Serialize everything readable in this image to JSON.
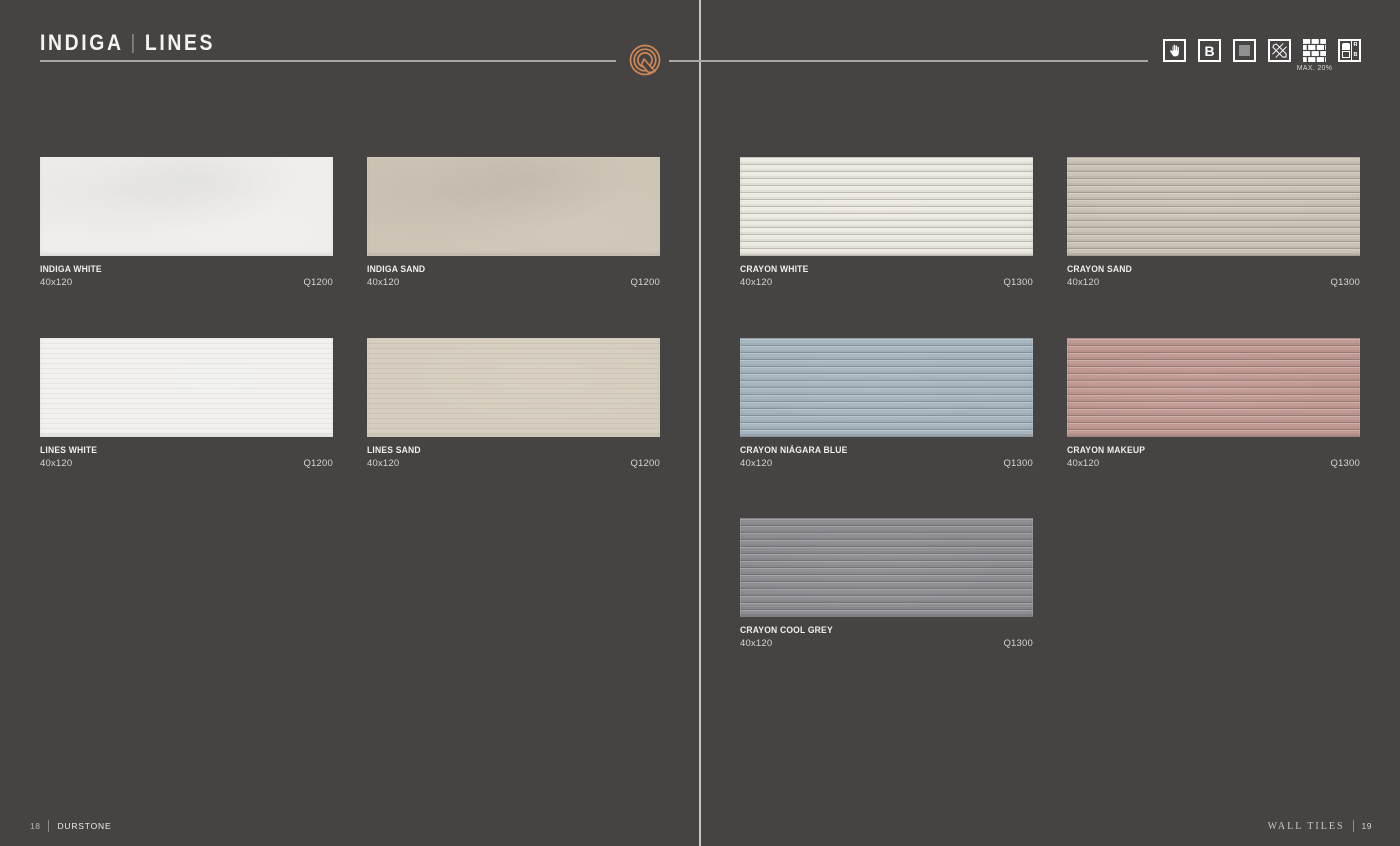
{
  "header": {
    "title_primary": "INDIGA",
    "title_separator": "|",
    "title_secondary": "LINES"
  },
  "brand": {
    "logo_letter": "Q",
    "accent_color": "#cf8756"
  },
  "legend": {
    "b_label": "B",
    "max_caption": "MAX. 20%",
    "rb_top": "R",
    "rb_bottom": "B"
  },
  "products": {
    "left": [
      {
        "name": "INDIGA WHITE",
        "size": "40x120",
        "code": "Q1200",
        "color": "#efeeea",
        "texture": "plain"
      },
      {
        "name": "INDIGA SAND",
        "size": "40x120",
        "code": "Q1200",
        "color": "#cdc5b6",
        "texture": "plain"
      },
      {
        "name": "LINES WHITE",
        "size": "40x120",
        "code": "Q1200",
        "color": "#f2f1ed",
        "texture": "lines"
      },
      {
        "name": "LINES SAND",
        "size": "40x120",
        "code": "Q1200",
        "color": "#d6cfc0",
        "texture": "lines"
      }
    ],
    "right": [
      {
        "name": "CRAYON WHITE",
        "size": "40x120",
        "code": "Q1300",
        "color": "#edeae1",
        "texture": "ridges"
      },
      {
        "name": "CRAYON SAND",
        "size": "40x120",
        "code": "Q1300",
        "color": "#cbc3b6",
        "texture": "ridges"
      },
      {
        "name": "CRAYON NIÁGARA BLUE",
        "size": "40x120",
        "code": "Q1300",
        "color": "#a8b6c0",
        "texture": "ridges"
      },
      {
        "name": "CRAYON MAKEUP",
        "size": "40x120",
        "code": "Q1300",
        "color": "#c29a94",
        "texture": "ridges"
      },
      {
        "name": "CRAYON COOL GREY",
        "size": "40x120",
        "code": "Q1300",
        "color": "#8f8e93",
        "texture": "ridges"
      }
    ]
  },
  "footer": {
    "left_page": "18",
    "left_brand": "DURSTONE",
    "right_section": "WALL TILES",
    "right_page": "19"
  }
}
